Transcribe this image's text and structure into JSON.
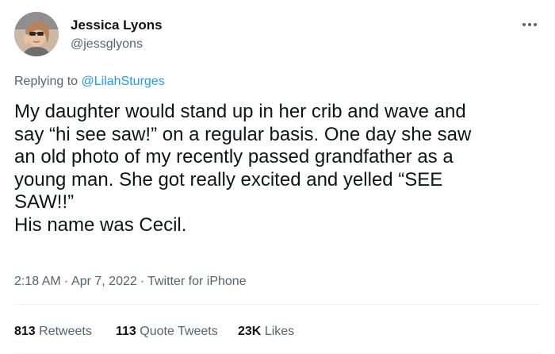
{
  "author": {
    "display_name": "Jessica Lyons",
    "handle": "@jessglyons",
    "avatar_icon": "profile-photo"
  },
  "more_icon": "more-horizontal-icon",
  "reply": {
    "prefix": "Replying to",
    "mention": "@LilahSturges"
  },
  "tweet": {
    "lines": [
      "My daughter would stand up in her crib and wave and",
      "say “hi see saw!” on a regular basis. One day she saw",
      "an old photo of my recently passed grandfather as a",
      "young man. She got really excited and yelled “SEE",
      "SAW!!”",
      "His name was Cecil."
    ]
  },
  "meta": {
    "time": "2:18 AM",
    "date": "Apr 7, 2022",
    "source": "Twitter for iPhone",
    "separator": "·"
  },
  "stats": {
    "retweets": {
      "count": "813",
      "label": "Retweets"
    },
    "quotes": {
      "count": "113",
      "label": "Quote Tweets"
    },
    "likes": {
      "count": "23K",
      "label": "Likes"
    }
  },
  "colors": {
    "text": "#0f1419",
    "secondary": "#536471",
    "link": "#1d9bf0",
    "divider": "#eff3f4"
  }
}
